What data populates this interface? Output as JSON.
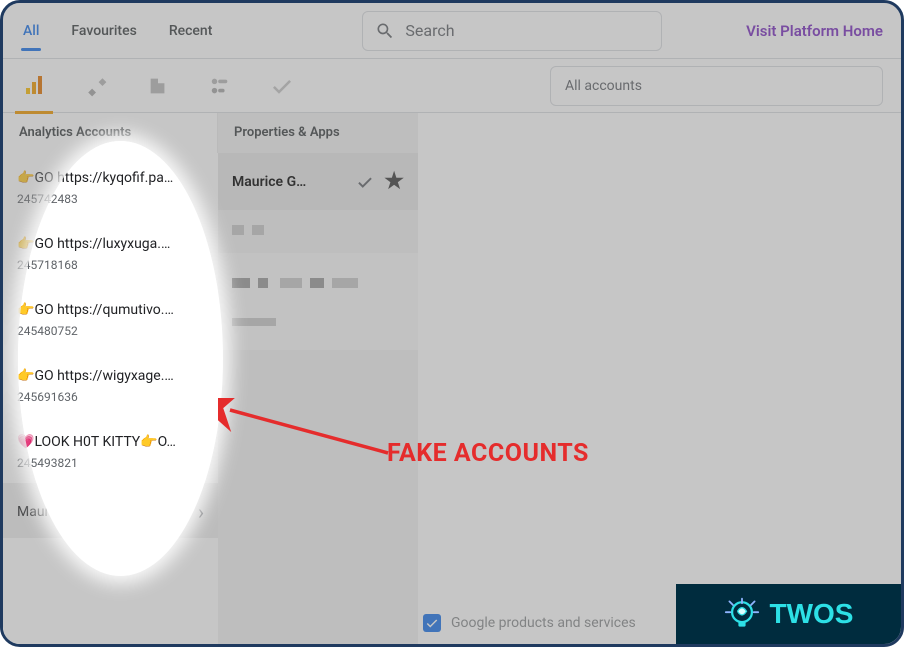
{
  "header": {
    "tabs": [
      {
        "id": "all",
        "label": "All",
        "active": true
      },
      {
        "id": "favourites",
        "label": "Favourites",
        "active": false
      },
      {
        "id": "recent",
        "label": "Recent",
        "active": false
      }
    ],
    "search_placeholder": "Search",
    "home_link": "Visit Platform Home"
  },
  "product_icons": [
    {
      "name": "analytics-icon",
      "active": true
    },
    {
      "name": "tag-manager-icon",
      "active": false
    },
    {
      "name": "optimize-icon",
      "active": false
    },
    {
      "name": "data-studio-icon",
      "active": false
    },
    {
      "name": "checkmark-icon",
      "active": false
    }
  ],
  "accounts_search_placeholder": "All accounts",
  "columns": {
    "accounts_header": "Analytics Accounts",
    "properties_header": "Properties & Apps"
  },
  "accounts": [
    {
      "emoji": "👉",
      "name": "GO https://kyqofif.pa…",
      "id": "245742483"
    },
    {
      "emoji": "👉",
      "name": "GO https://luxyxuga.…",
      "id": "245718168"
    },
    {
      "emoji": "👉",
      "name": "GO https://qumutivo.…",
      "id": "245480752"
    },
    {
      "emoji": "👉",
      "name": "GO https://wigyxage.…",
      "id": "245691636"
    },
    {
      "emoji": "💗",
      "name": "LOOK H0T KITTY👉O…",
      "id": "245493821"
    },
    {
      "emoji": "",
      "name": "Maurice ▓▓▓▓",
      "id": "▓▓▓▓▓▓▓▓",
      "current": true
    }
  ],
  "properties": [
    {
      "name": "Maurice G…",
      "selected": true,
      "starred": true
    }
  ],
  "bottom": {
    "checked": true,
    "label_truncated": "Google products and services"
  },
  "annotation": {
    "label": "FAKE ACCOUNTS",
    "color": "#e52c2c"
  },
  "watermark": {
    "text": "TWOS"
  }
}
